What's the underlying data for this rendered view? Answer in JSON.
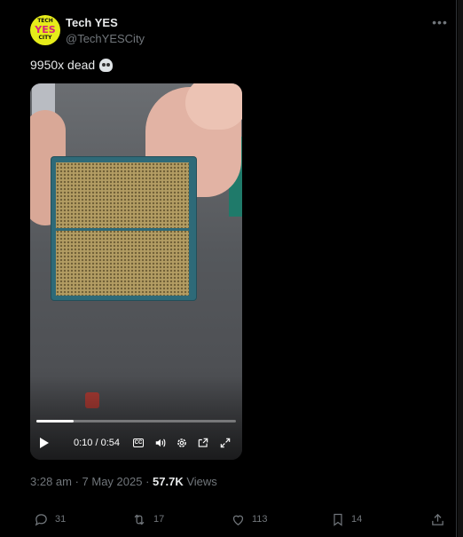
{
  "author": {
    "name": "Tech YES",
    "handle": "@TechYESCity",
    "avatar_text": {
      "top": "TECH",
      "middle": "YES",
      "bottom": "CITY"
    }
  },
  "more_icon": "ellipsis-icon",
  "tweet": {
    "text": "9950x dead",
    "emoji": "skull"
  },
  "video": {
    "time": "0:10 / 0:54",
    "progress_fraction": 0.185,
    "controls": [
      "play-icon",
      "captions-icon",
      "volume-icon",
      "settings-icon",
      "picture-in-picture-icon",
      "fullscreen-icon"
    ],
    "cc_label": "CC"
  },
  "meta": {
    "timestamp": "3:28 am · 7 May 2025 · ",
    "views_count": "57.7K",
    "views_label": " Views"
  },
  "actions": {
    "reply": "31",
    "retweet": "17",
    "like": "113",
    "bookmark": "14"
  },
  "colors": {
    "background": "#000000",
    "text_primary": "#e7e9ea",
    "text_secondary": "#71767b",
    "avatar_bg": "#e6ec1a",
    "avatar_accent": "#d6257a"
  }
}
